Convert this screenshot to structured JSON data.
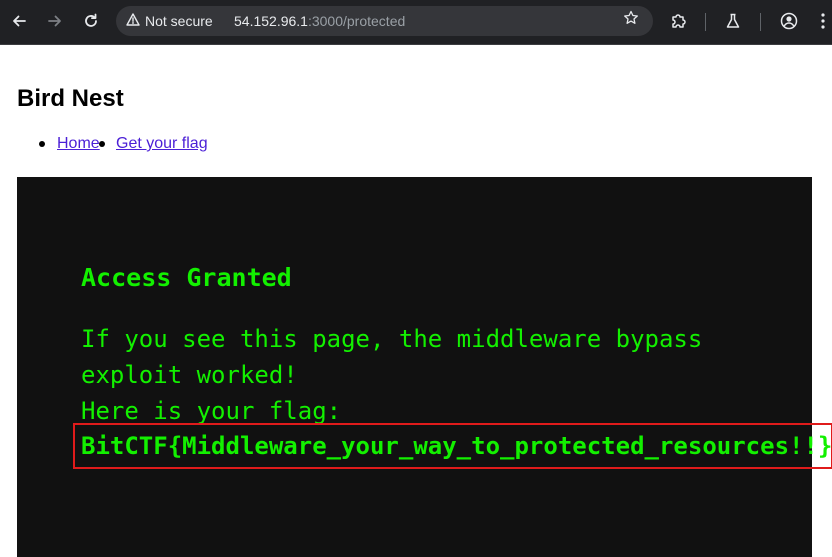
{
  "browser": {
    "back_icon": "arrow-left-icon",
    "forward_icon": "arrow-right-icon",
    "reload_icon": "reload-icon",
    "security_label": "Not secure",
    "url_host": "54.152.96.1",
    "url_path": ":3000/protected",
    "bookmark_icon": "star-icon",
    "extensions_icon": "puzzle-icon",
    "labs_icon": "flask-icon",
    "profile_icon": "account-icon"
  },
  "page": {
    "site_title": "Bird Nest",
    "nav": [
      {
        "label": "Home"
      },
      {
        "label": "Get your flag"
      }
    ]
  },
  "terminal": {
    "heading": "Access Granted",
    "line1": "If you see this page, the middleware bypass",
    "line2": "exploit worked!",
    "line3": "Here is your flag:",
    "flag": "BitCTF{Middleware_your_way_to_protected_resources!!}",
    "background": "#111111",
    "text_color": "#13f000",
    "highlight_color": "#e01b1b"
  }
}
